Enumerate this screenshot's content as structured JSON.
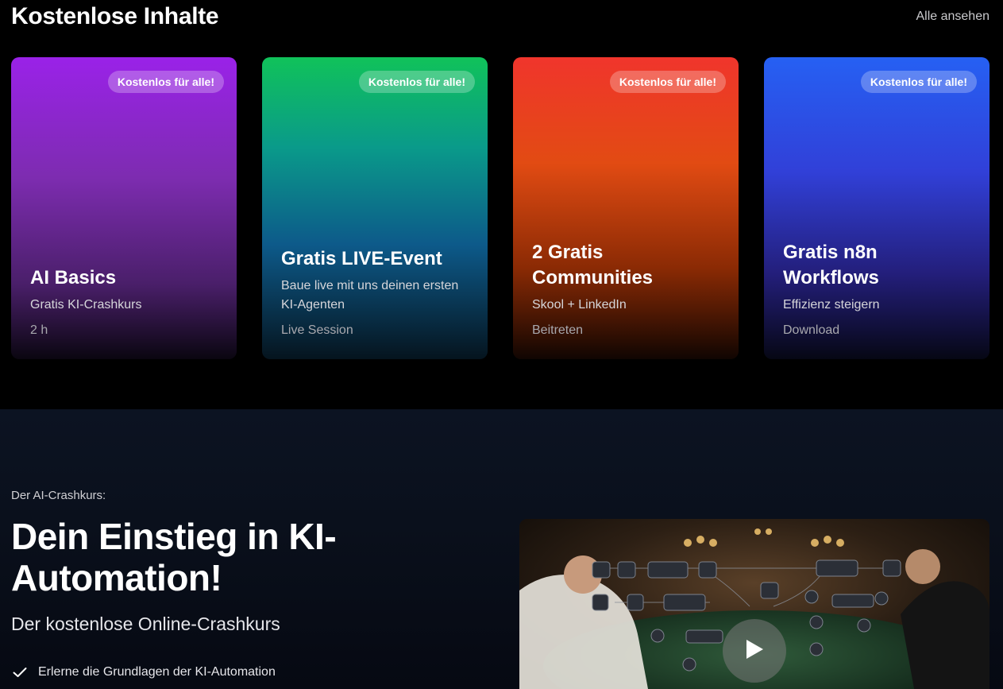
{
  "section": {
    "title": "Kostenlose Inhalte",
    "view_all": "Alle ansehen"
  },
  "cards": [
    {
      "badge": "Kostenlos für alle!",
      "title": "AI Basics",
      "subtitle": "Gratis KI-Crashkurs",
      "meta": "2 h"
    },
    {
      "badge": "Kostenlos für alle!",
      "title": "Gratis LIVE-Event",
      "subtitle": "Baue live mit uns deinen ersten KI-Agenten",
      "meta": "Live Session"
    },
    {
      "badge": "Kostenlos für alle!",
      "title": "2 Gratis Communities",
      "subtitle": "Skool + LinkedIn",
      "meta": "Beitreten"
    },
    {
      "badge": "Kostenlos für alle!",
      "title": "Gratis n8n Workflows",
      "subtitle": "Effizienz steigern",
      "meta": "Download"
    }
  ],
  "crashkurs": {
    "kicker": "Der AI-Crashkurs:",
    "headline": "Dein Einstieg in KI-Automation!",
    "subheadline": "Der kostenlose Online-Crashkurs",
    "bullets": [
      "Erlerne die Grundlagen der KI-Automation"
    ]
  },
  "video": {
    "icon": "play-icon"
  }
}
